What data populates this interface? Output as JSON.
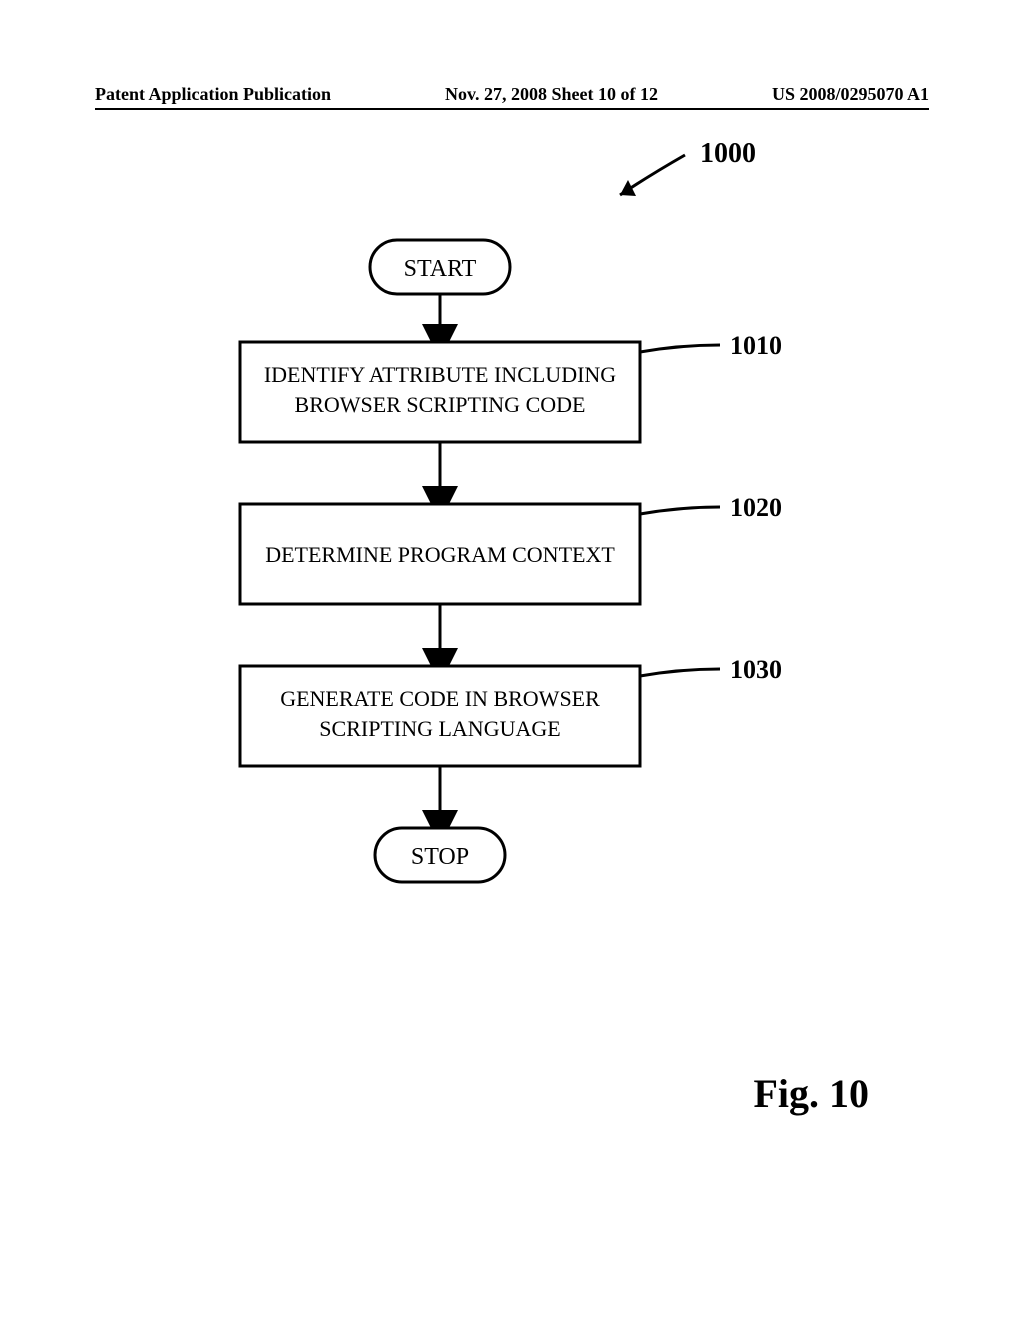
{
  "header": {
    "left": "Patent Application Publication",
    "center": "Nov. 27, 2008  Sheet 10 of 12",
    "right": "US 2008/0295070 A1"
  },
  "figure": {
    "number_label": "1000",
    "start": "START",
    "stop": "STOP",
    "caption": "Fig. 10",
    "steps": [
      {
        "ref": "1010",
        "line1": "IDENTIFY ATTRIBUTE INCLUDING",
        "line2": "BROWSER SCRIPTING CODE"
      },
      {
        "ref": "1020",
        "line1": "DETERMINE PROGRAM CONTEXT",
        "line2": ""
      },
      {
        "ref": "1030",
        "line1": "GENERATE CODE IN BROWSER",
        "line2": "SCRIPTING LANGUAGE"
      }
    ]
  }
}
